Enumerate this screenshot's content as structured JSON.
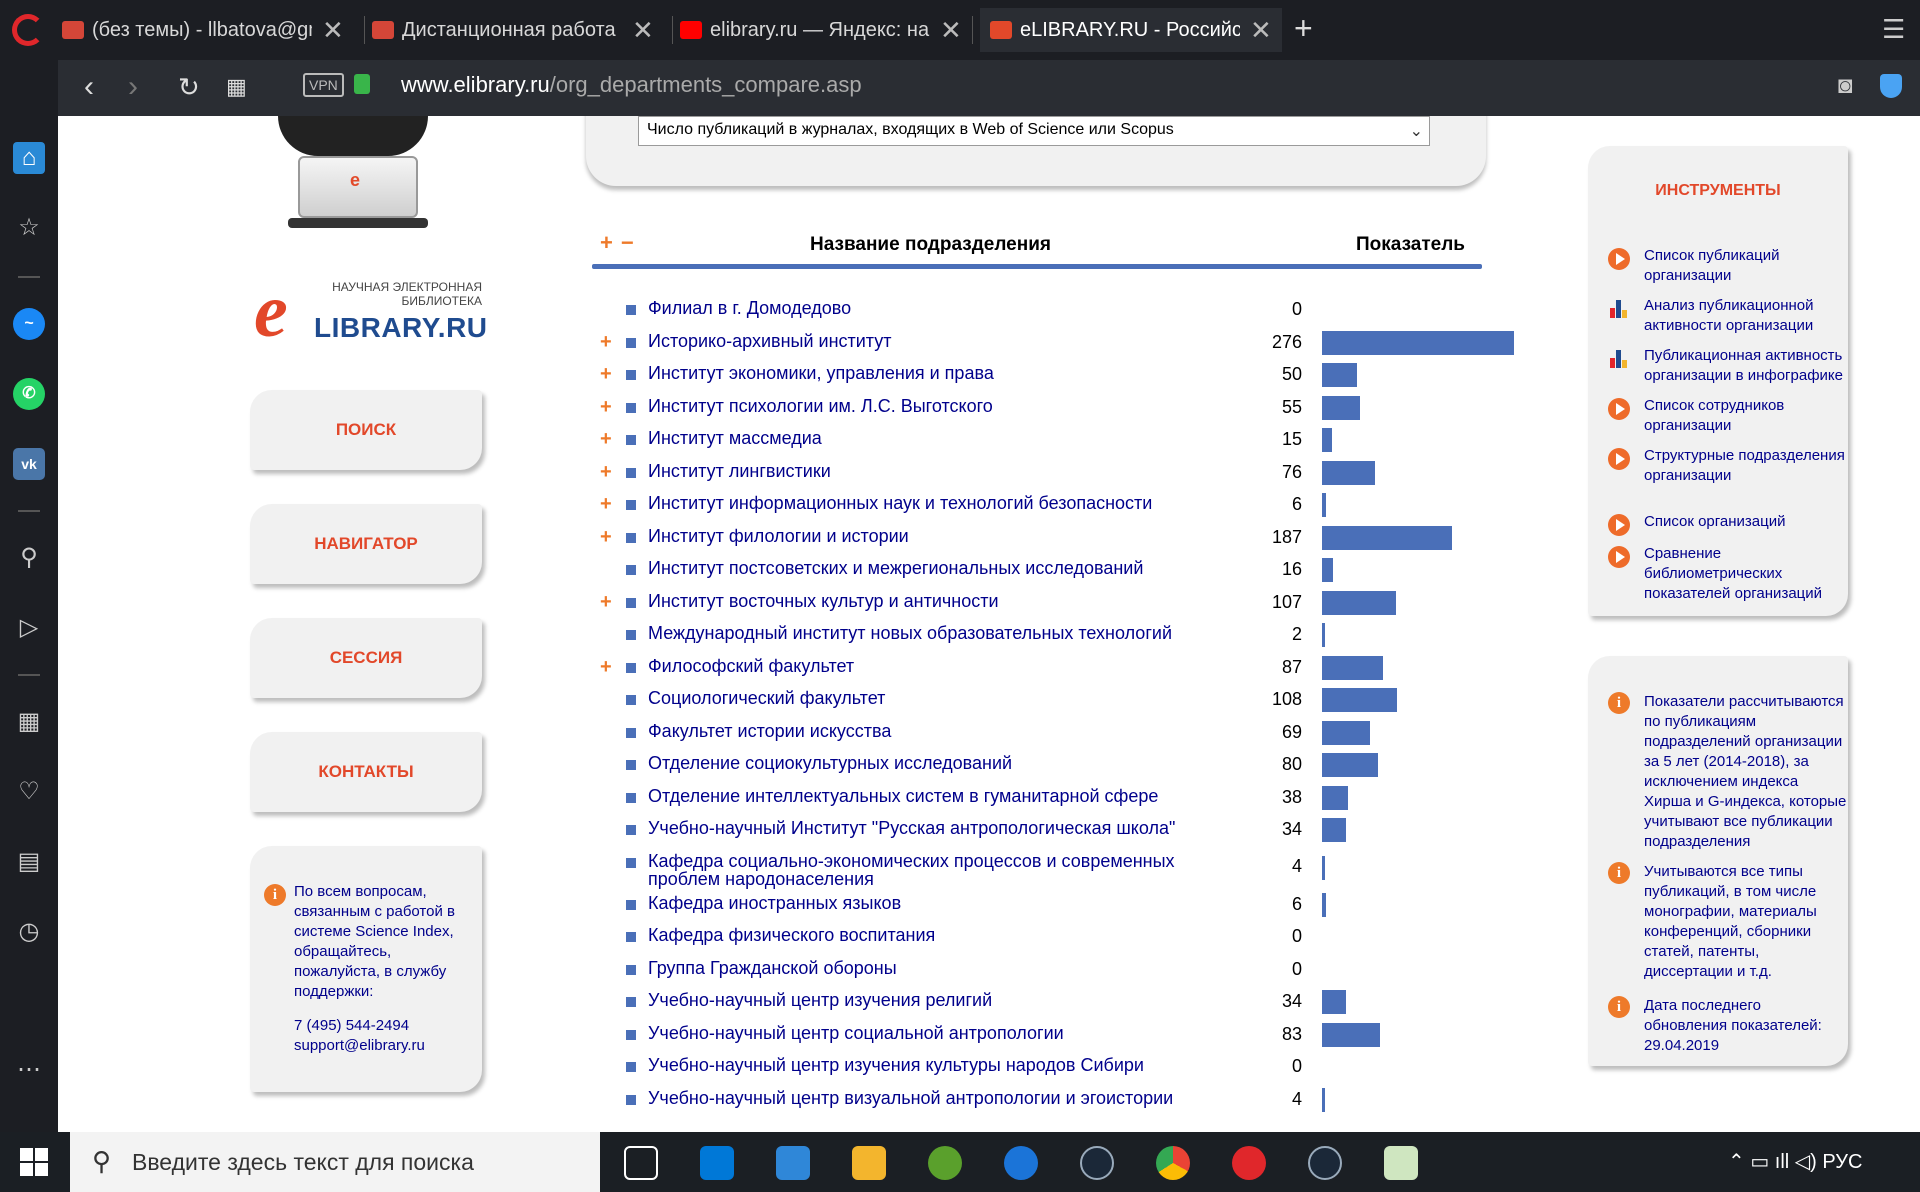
{
  "browser": {
    "tabs": [
      {
        "label": "(без темы) - llbatova@gm",
        "icon": "gmail-icon",
        "color": "#d44638",
        "active": false
      },
      {
        "label": "Дистанционная работа - I",
        "icon": "gmail-icon",
        "color": "#d44638",
        "active": false
      },
      {
        "label": "elibrary.ru — Яндекс: нашл",
        "icon": "yandex-icon",
        "color": "#ff0000",
        "active": false
      },
      {
        "label": "eLIBRARY.RU - Российский",
        "icon": "elibrary-icon",
        "color": "#e2482a",
        "active": true
      }
    ],
    "close_glyph": "✕",
    "new_tab_glyph": "+",
    "vpn_label": "VPN",
    "url_domain": "www.elibrary.ru",
    "url_path": "/org_departments_compare.asp"
  },
  "left": {
    "logo_top": "НАУЧНАЯ ЭЛЕКТРОННАЯ БИБЛИОТЕКА",
    "logo_e": "e",
    "logo_main": "LIBRARY.RU",
    "menu": [
      {
        "label": "ПОИСК",
        "name": "search-menu-button"
      },
      {
        "label": "НАВИГАТОР",
        "name": "navigator-menu-button"
      },
      {
        "label": "СЕССИЯ",
        "name": "session-menu-button"
      },
      {
        "label": "КОНТАКТЫ",
        "name": "contacts-menu-button"
      }
    ],
    "help_text": "По всем вопросам, связанным с работой в системе Science Index, обращайтесь, пожалуйста, в службу поддержки:",
    "help_phone": "7 (495) 544-2494",
    "help_email": "support@elibrary.ru"
  },
  "center": {
    "select_value": "Число публикаций в журналах, входящих в Web of Science или Scopus",
    "expand_all": "+",
    "collapse_all": "−",
    "col_name": "Название подразделения",
    "col_value": "Показатель",
    "max_value": 276
  },
  "chart_data": {
    "type": "bar",
    "title": "",
    "xlabel": "",
    "ylabel": "Показатель",
    "categories": [
      "Филиал в г. Домодедово",
      "Историко-архивный институт",
      "Институт экономики, управления и права",
      "Институт психологии им. Л.С. Выготского",
      "Институт массмедиа",
      "Институт лингвистики",
      "Институт информационных наук и технологий безопасности",
      "Институт филологии и истории",
      "Институт постсоветских и межрегиональных исследований",
      "Институт восточных культур и античности",
      "Международный институт новых образовательных технологий",
      "Философский факультет",
      "Социологический факультет",
      "Факультет истории искусства",
      "Отделение социокультурных исследований",
      "Отделение интеллектуальных систем в гуманитарной сфере",
      "Учебно-научный Институт \"Русская антропологическая школа\"",
      "Кафедра социально-экономических процессов и современных проблем народонаселения",
      "Кафедра иностранных языков",
      "Кафедра физического воспитания",
      "Группа Гражданской обороны",
      "Учебно-научный центр изучения религий",
      "Учебно-научный центр социальной антропологии",
      "Учебно-научный центр изучения культуры народов Сибири",
      "Учебно-научный центр визуальной антропологии и эгоистории"
    ],
    "values": [
      0,
      276,
      50,
      55,
      15,
      76,
      6,
      187,
      16,
      107,
      2,
      87,
      108,
      69,
      80,
      38,
      34,
      4,
      6,
      0,
      0,
      34,
      83,
      0,
      4
    ],
    "expandable": [
      false,
      true,
      true,
      true,
      true,
      true,
      true,
      true,
      false,
      true,
      false,
      true,
      false,
      false,
      false,
      false,
      false,
      false,
      false,
      false,
      false,
      false,
      false,
      false,
      false
    ]
  },
  "tools": {
    "title": "ИНСТРУМЕНТЫ",
    "items": [
      {
        "label": "Список публикаций организации",
        "icon": "play"
      },
      {
        "label": "Анализ публикационной активности организации",
        "icon": "bars"
      },
      {
        "label": "Публикационная активность организации в инфографике",
        "icon": "bars"
      },
      {
        "label": "Список сотрудников организации",
        "icon": "play"
      },
      {
        "label": "Структурные подразделения организации",
        "icon": "play"
      },
      {
        "label": "Список организаций",
        "icon": "play"
      },
      {
        "label": "Сравнение библиометрических показателей организаций",
        "icon": "play"
      }
    ]
  },
  "notes": [
    "Показатели рассчитываются по публикациям подразделений организации за 5 лет (2014-2018), за исключением индекса Хирша и G-индекса, которые учитывают все публикации подразделения",
    "Учитываются все типы публикаций, в том числе монографии, материалы конференций, сборники статей, патенты, диссертации и т.д.",
    "Дата последнего обновления показателей: 29.04.2019"
  ],
  "taskbar": {
    "search_placeholder": "Введите здесь текст для поиска",
    "lang": "РУС"
  },
  "colors": {
    "accent_orange": "#ee7a2a",
    "brand_red": "#e2482a",
    "bar_blue": "#4a6fb8",
    "link_navy": "#00008b"
  }
}
